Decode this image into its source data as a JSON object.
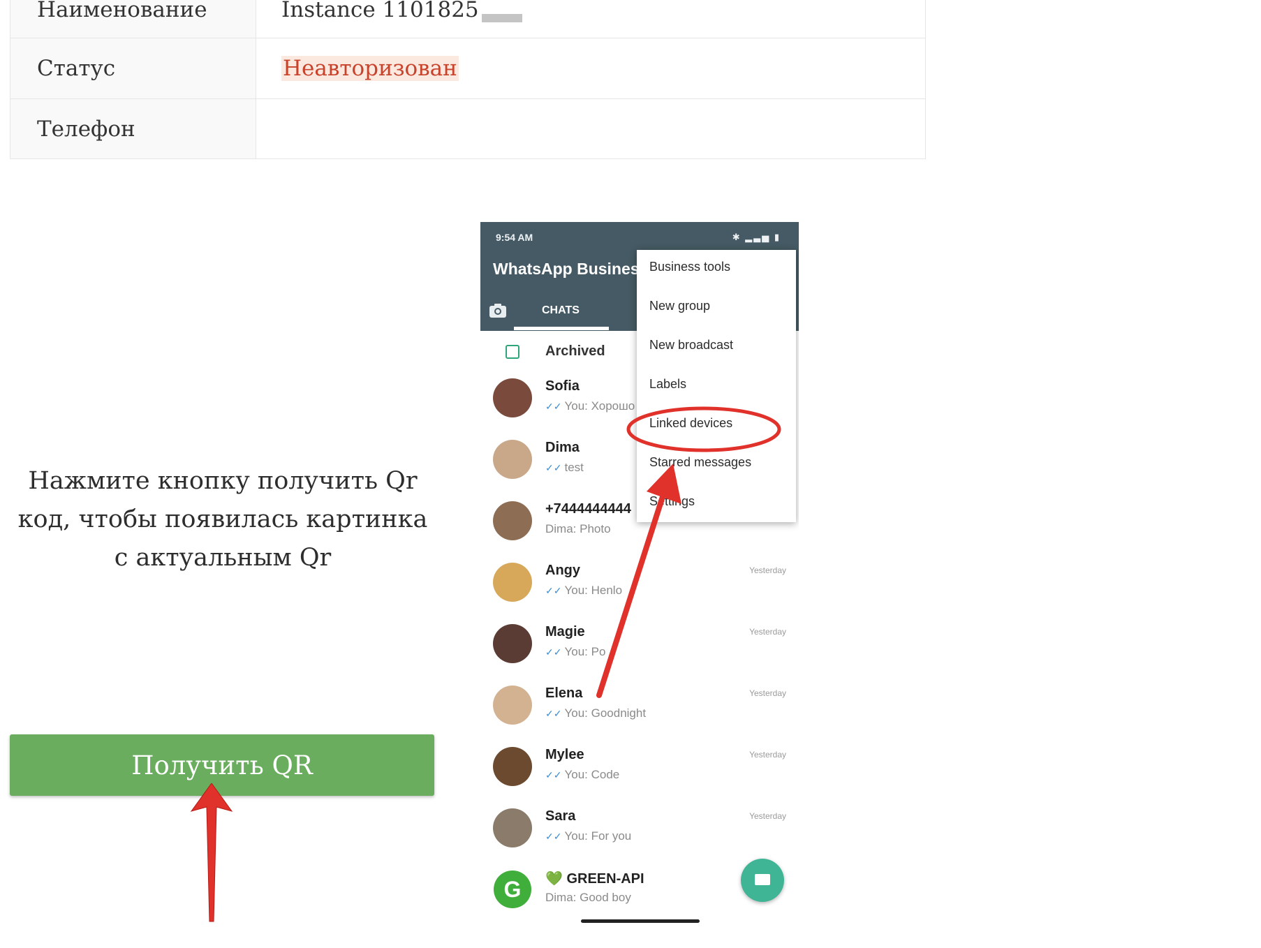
{
  "info_table": {
    "rows": [
      {
        "label": "Наименование",
        "value": "Instance 1101825"
      },
      {
        "label": "Статус",
        "value": "Неавторизован"
      },
      {
        "label": "Телефон",
        "value": ""
      }
    ]
  },
  "instruction_text": "Нажмите кнопку получить Qr код, чтобы появилась картинка с актуальным Qr",
  "qr_button_label": "Получить QR",
  "colors": {
    "button_green": "#6aad5e",
    "status_red": "#c8432c",
    "whatsapp_header": "#455a64",
    "arrow_red": "#e0312a"
  },
  "phone": {
    "status_time": "9:54 AM",
    "app_title": "WhatsApp Business",
    "tab_chats": "CHATS",
    "archived": "Archived",
    "menu": [
      "Business tools",
      "New group",
      "New broadcast",
      "Labels",
      "Linked devices",
      "Starred messages",
      "Settings"
    ],
    "chats": [
      {
        "name": "Sofia",
        "preview": "You: Хорошо",
        "time": ""
      },
      {
        "name": "Dima",
        "preview": "test",
        "time": ""
      },
      {
        "name": "+7444444444",
        "preview": "Dima: Photo",
        "time": ""
      },
      {
        "name": "Angy",
        "preview": "You: Henlo",
        "time": "Yesterday"
      },
      {
        "name": "Magie",
        "preview": "You: Po",
        "time": "Yesterday"
      },
      {
        "name": "Elena",
        "preview": "You: Goodnight",
        "time": "Yesterday"
      },
      {
        "name": "Mylee",
        "preview": "You: Code",
        "time": "Yesterday"
      },
      {
        "name": "Sara",
        "preview": "You: For you",
        "time": "Yesterday"
      },
      {
        "name": "💚 GREEN-API",
        "preview": "Dima: Good boy",
        "time": ""
      }
    ]
  }
}
